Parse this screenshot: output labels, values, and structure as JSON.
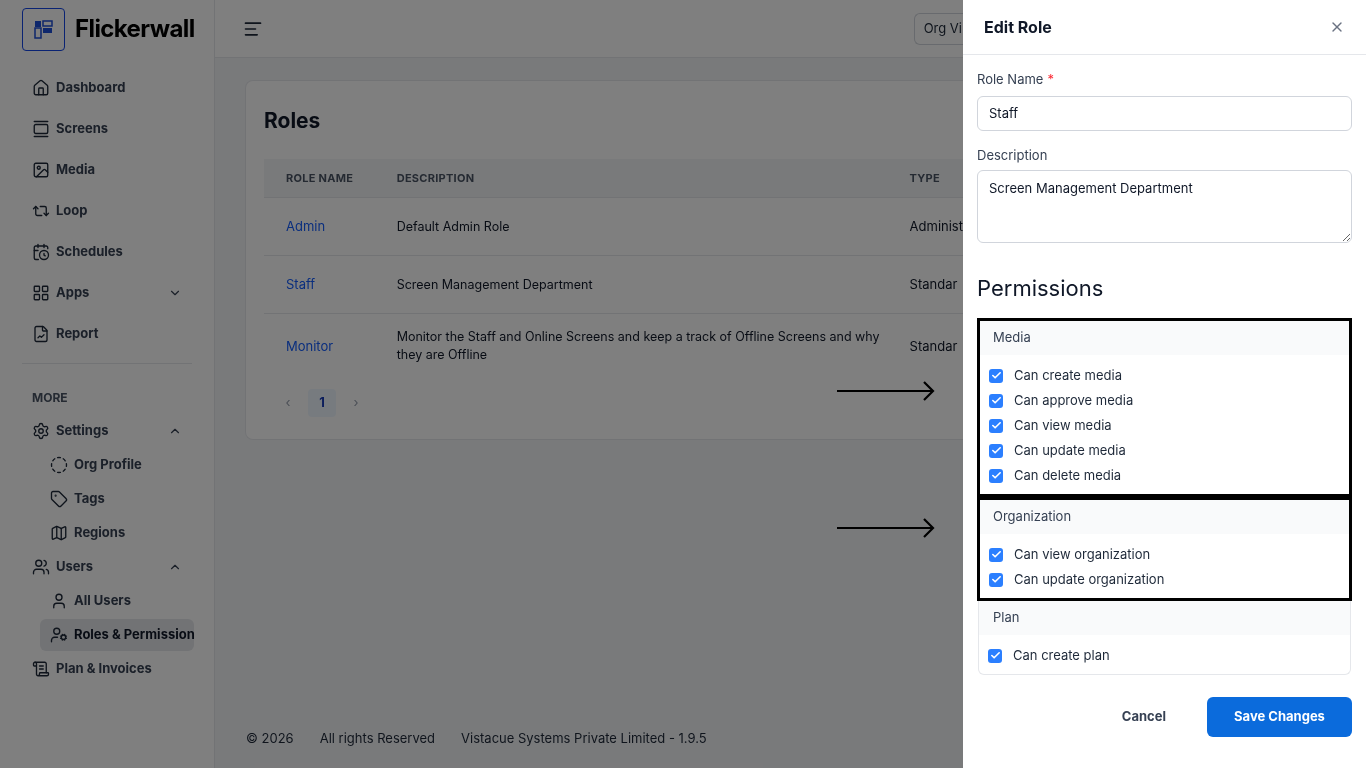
{
  "sidebar": {
    "brand": "Flickerwall",
    "items": [
      {
        "label": "Dashboard",
        "selected": false
      },
      {
        "label": "Screens",
        "selected": false
      },
      {
        "label": "Media",
        "selected": false
      },
      {
        "label": "Loop",
        "selected": false
      },
      {
        "label": "Schedules",
        "selected": false
      },
      {
        "label": "Apps",
        "selected": false,
        "expanded": false
      },
      {
        "label": "Report",
        "selected": false
      }
    ],
    "more_label": "MORE",
    "more_items": [
      {
        "label": "Settings",
        "selected": false,
        "expanded": true,
        "children": [
          {
            "label": "Org Profile",
            "selected": false
          },
          {
            "label": "Tags",
            "selected": false
          },
          {
            "label": "Regions",
            "selected": false
          }
        ]
      },
      {
        "label": "Users",
        "selected": false,
        "expanded": true,
        "children": [
          {
            "label": "All Users",
            "selected": false
          },
          {
            "label": "Roles & Permission",
            "selected": true
          }
        ]
      },
      {
        "label": "Plan & Invoices",
        "selected": false
      }
    ]
  },
  "topbar": {
    "org_button": "Org Vi"
  },
  "roles": {
    "title": "Roles",
    "columns": [
      "ROLE NAME",
      "DESCRIPTION",
      "TYPE"
    ],
    "rows": [
      {
        "name": "Admin",
        "description": "Default Admin Role",
        "type": "Administ"
      },
      {
        "name": "Staff",
        "description": "Screen Management Department",
        "type": "Standar"
      },
      {
        "name": "Monitor",
        "description": "Monitor the Staff and Online Screens and keep a track of Offline Screens and why they are Offline",
        "type": "Standar"
      }
    ],
    "pagination": {
      "prev": "‹",
      "pages": [
        {
          "label": "1",
          "selected": true
        }
      ],
      "next": "›"
    }
  },
  "footer": {
    "copyright": "© 2026",
    "rights": "All rights Reserved",
    "company": "Vistacue Systems Private Limited - 1.9.5"
  },
  "drawer": {
    "title": "Edit Role",
    "role_name": {
      "label": "Role Name",
      "required_mark": "*",
      "value": "Staff"
    },
    "description": {
      "label": "Description",
      "value": "Screen Management Department"
    },
    "permissions_title": "Permissions",
    "groups": [
      {
        "name": "Media",
        "highlighted": true,
        "permissions": [
          {
            "label": "Can create media",
            "checked": true
          },
          {
            "label": "Can approve media",
            "checked": true
          },
          {
            "label": "Can view media",
            "checked": true
          },
          {
            "label": "Can update media",
            "checked": true
          },
          {
            "label": "Can delete media",
            "checked": true
          }
        ]
      },
      {
        "name": "Organization",
        "highlighted": true,
        "permissions": [
          {
            "label": "Can view organization",
            "checked": true
          },
          {
            "label": "Can update organization",
            "checked": true
          }
        ]
      },
      {
        "name": "Plan",
        "highlighted": false,
        "permissions": [
          {
            "label": "Can create plan",
            "checked": true
          }
        ]
      }
    ],
    "cancel": "Cancel",
    "save": "Save Changes"
  }
}
